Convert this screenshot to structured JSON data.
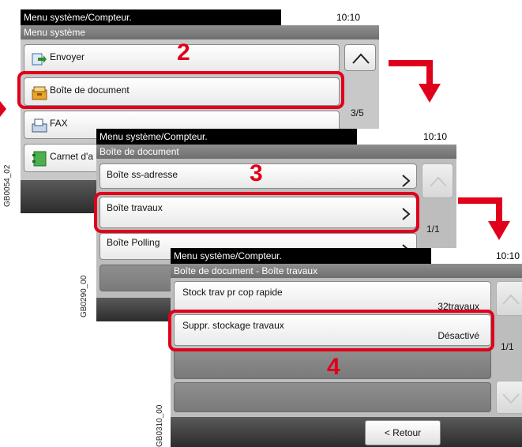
{
  "screen1": {
    "title": "Menu système/Compteur.",
    "time": "10:10",
    "subtitle": "Menu système",
    "items": [
      {
        "label": "Envoyer"
      },
      {
        "label": "Boîte de document"
      },
      {
        "label": "FAX"
      },
      {
        "label": "Carnet d'a"
      }
    ],
    "page_indicator": "3/5",
    "code": "GB0054_02",
    "step": "2"
  },
  "screen2": {
    "title": "Menu système/Compteur.",
    "time": "10:10",
    "subtitle": "Boîte de document",
    "items": [
      {
        "label": "Boîte ss-adresse"
      },
      {
        "label": "Boîte travaux"
      },
      {
        "label": "Boîte Polling"
      }
    ],
    "page_indicator": "1/1",
    "code": "GB0290_00",
    "step": "3"
  },
  "screen3": {
    "title": "Menu système/Compteur.",
    "time": "10:10",
    "subtitle": "Boîte de document - Boîte travaux",
    "items": [
      {
        "label": "Stock trav pr cop rapide",
        "value": "32travaux"
      },
      {
        "label": "Suppr. stockage travaux",
        "value": "Désactivé"
      }
    ],
    "page_indicator": "1/1",
    "back_label": "< Retour",
    "code": "GB0310_00",
    "step": "4"
  },
  "colors": {
    "highlight": "#e0001b",
    "title_bar": "#000000",
    "subtitle_bar": "#7a7a7a",
    "panel": "#bdbdbd"
  }
}
